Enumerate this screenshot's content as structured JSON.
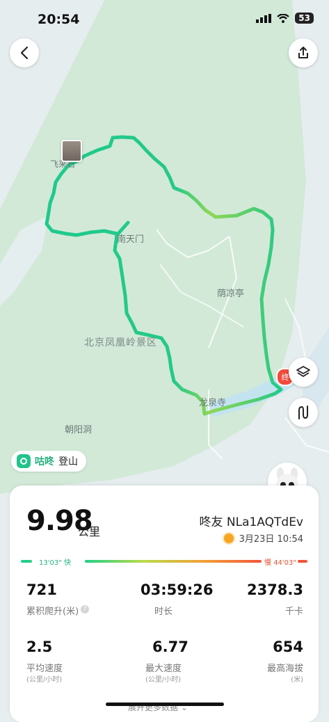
{
  "status_bar": {
    "time": "20:54",
    "battery": "53"
  },
  "map": {
    "labels": {
      "nantianmen": "南天门",
      "yinliangting": "荫凉亭",
      "scenic_area": "北京凤凰岭景区",
      "longquansi": "龙泉寺",
      "chaoyangdong": "朝阳洞",
      "feilai": "飞来石"
    },
    "end_marker": "终",
    "route_colors": {
      "fast": "#22c98a",
      "mid": "#a7d64c",
      "water": "#bfe3ef",
      "forest": "#cfe8d6"
    }
  },
  "brand": {
    "name": "咕咚",
    "activity": "登山"
  },
  "summary": {
    "distance": "9.98",
    "distance_unit": "公里",
    "username": "咚友 NLa1AQTdEv",
    "date": "3月23日 10:54",
    "pace_fast": "13'03\" 快",
    "pace_slow": "慢 44'03\""
  },
  "stats": [
    {
      "value": "721",
      "label": "累积爬升(米)"
    },
    {
      "value": "03:59:26",
      "label": "时长"
    },
    {
      "value": "2378.3",
      "label": "千卡"
    },
    {
      "value": "2.5",
      "label": "平均速度",
      "sub": "(公里/小时)"
    },
    {
      "value": "6.77",
      "label": "最大速度",
      "sub": "(公里/小时)"
    },
    {
      "value": "654",
      "label": "最高海拔",
      "sub": "(米)"
    }
  ],
  "more_data": "展开更多数据"
}
